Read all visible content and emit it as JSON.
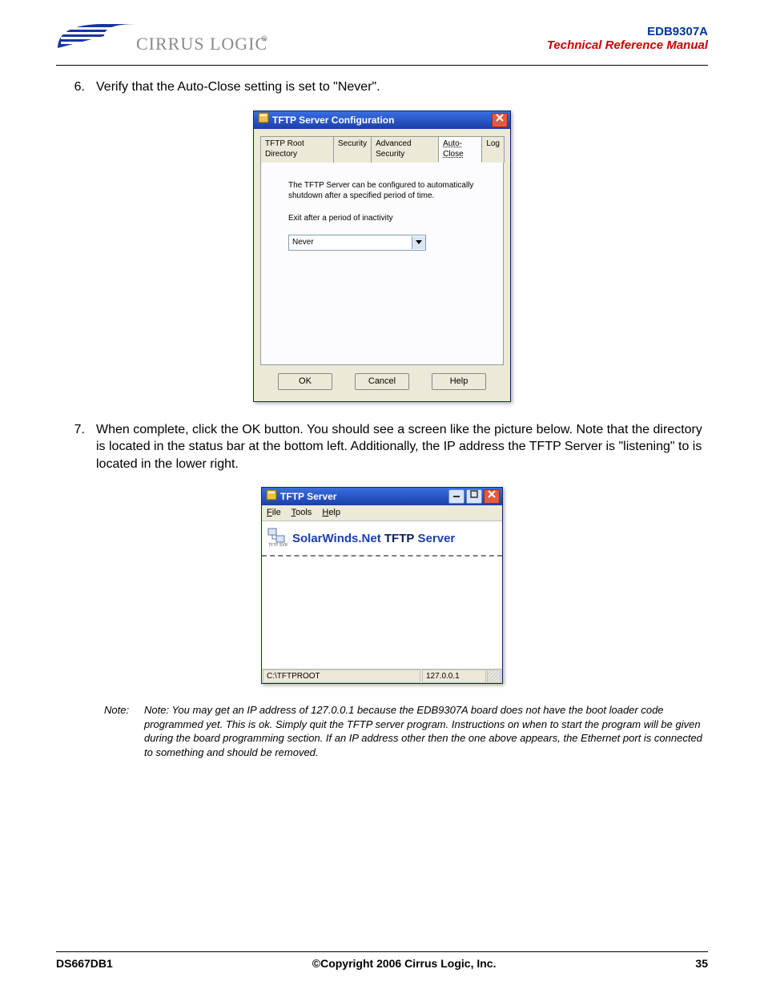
{
  "header": {
    "logo_text": "CIRRUS LOGIC",
    "model": "EDB9307A",
    "manual": "Technical Reference Manual"
  },
  "step6": {
    "num": "6.",
    "text": "Verify that the Auto-Close setting is set to \"Never\"."
  },
  "step7": {
    "num": "7.",
    "text": "When complete, click the OK button. You should see a screen like the picture below. Note that the directory is located in the status bar at the bottom left. Additionally, the IP address the TFTP Server is \"listening\" to is located in the lower right."
  },
  "win1": {
    "title": "TFTP Server Configuration",
    "tabs": {
      "root": "TFTP Root Directory",
      "security": "Security",
      "advsec": "Advanced Security",
      "autoclose": "Auto-Close",
      "log": "Log"
    },
    "panel": {
      "desc": "The TFTP Server can be configured to automatically shutdown after a specified period of time.",
      "label": "Exit after a period of inactivity",
      "value": "Never"
    },
    "buttons": {
      "ok": "OK",
      "cancel": "Cancel",
      "help": "Help"
    }
  },
  "win2": {
    "title": "TFTP Server",
    "menu": {
      "file": "File",
      "tools": "Tools",
      "help": "Help"
    },
    "banner_prefix": "SolarWinds.Net ",
    "banner_strong": "TFTP",
    "banner_suffix": " Server",
    "status_left": "C:\\TFTPROOT",
    "status_right": "127.0.0.1"
  },
  "note": {
    "label": "Note:",
    "text": "Note: You may get an IP address of 127.0.0.1 because the EDB9307A board does not have the boot loader code programmed yet. This is ok. Simply quit the TFTP server program. Instructions on when to start the program will be given during the board programming section. If an IP address other then the one above appears, the Ethernet port is connected to something and should be removed."
  },
  "footer": {
    "left": "DS667DB1",
    "center": "©Copyright 2006 Cirrus Logic, Inc.",
    "right": "35"
  }
}
